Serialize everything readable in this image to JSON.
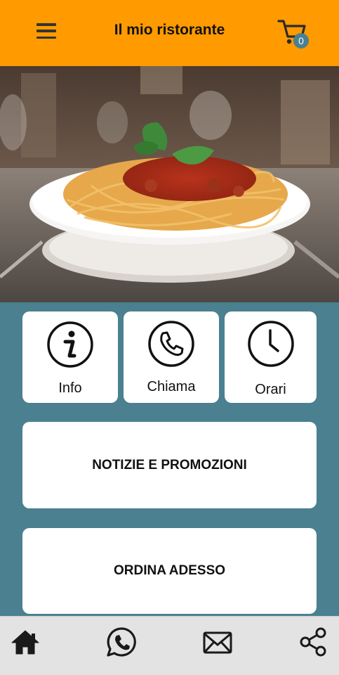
{
  "header": {
    "title": "Il mio ristorante",
    "cart_count": "0",
    "bar_color": "#FF9A00"
  },
  "hero": {
    "image": "spaghetti-bolognese-photo"
  },
  "tiles": [
    {
      "label": "Info",
      "icon": "info-icon"
    },
    {
      "label": "Chiama",
      "icon": "phone-icon"
    },
    {
      "label": "Orari",
      "icon": "clock-icon"
    }
  ],
  "buttons": {
    "news": "NOTIZIE E PROMOZIONI",
    "order": "ORDINA ADESSO"
  },
  "bottom_nav": [
    "home-icon",
    "whatsapp-icon",
    "mail-icon",
    "share-icon"
  ],
  "colors": {
    "accent": "#FF9A00",
    "background": "#4A8090",
    "card": "#FFFFFF",
    "bottom_bar": "#E3E3E3"
  }
}
